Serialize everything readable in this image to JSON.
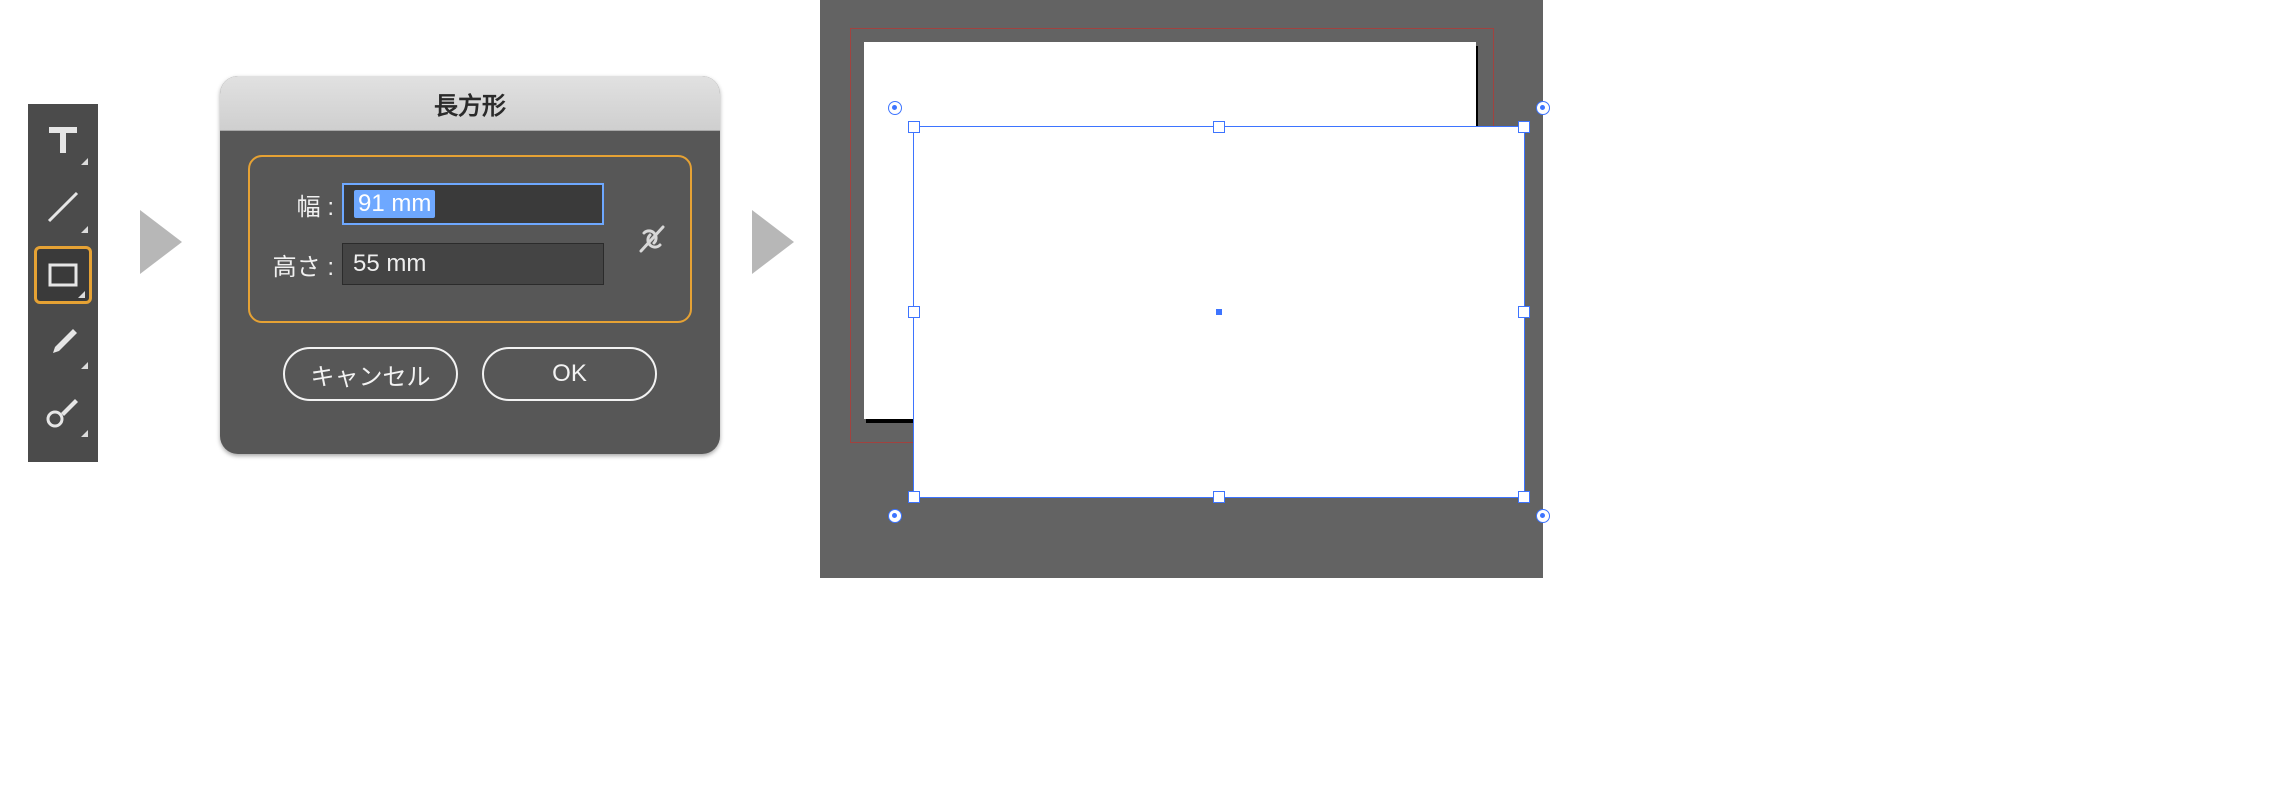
{
  "toolbar": {
    "tools": [
      {
        "name": "type-tool"
      },
      {
        "name": "line-tool"
      },
      {
        "name": "rectangle-tool",
        "selected": true
      },
      {
        "name": "brush-tool"
      },
      {
        "name": "blob-brush-tool"
      }
    ]
  },
  "dialog": {
    "title": "長方形",
    "width_label": "幅 :",
    "width_value": "91 mm",
    "height_label": "高さ :",
    "height_value": "55 mm",
    "link_constrain": false,
    "cancel_label": "キャンセル",
    "ok_label": "OK"
  },
  "canvas": {
    "rectangle_width_mm": 91,
    "rectangle_height_mm": 55
  }
}
